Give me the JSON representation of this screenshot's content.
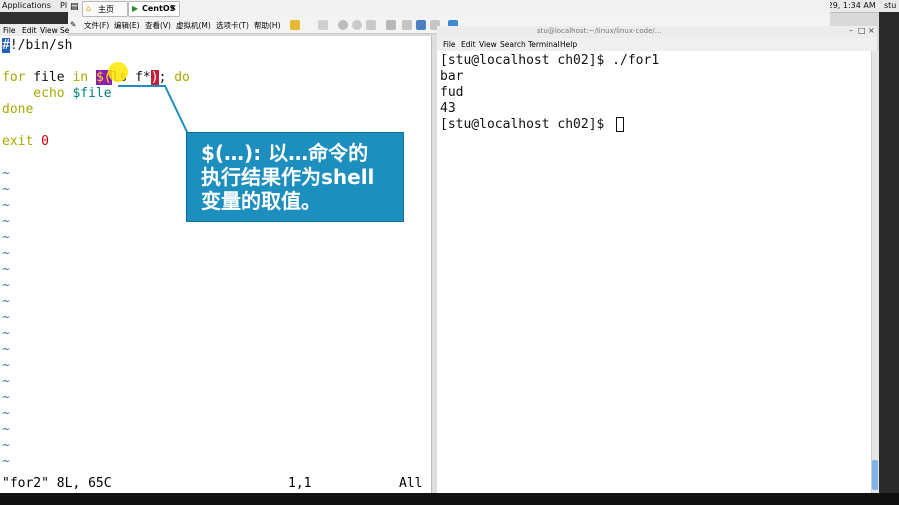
{
  "topbar": {
    "applications": "Applications",
    "places": "Pl",
    "clock": "n 29, 1:34 AM",
    "user": "stu"
  },
  "vm": {
    "tab_home": "主页",
    "tab_centos": "CentOS",
    "menus": [
      "文件(F)",
      "编辑(E)",
      "查看(V)",
      "虚拟机(M)",
      "选项卡(T)",
      "帮助(H)"
    ]
  },
  "vim": {
    "menus": [
      "File",
      "Edit",
      "View",
      "Se"
    ],
    "lines": {
      "shebang_hash": "#",
      "shebang_rest": "!/bin/sh",
      "for_kw": "for",
      "for_var": " file ",
      "in_kw": "in",
      "dollar": "$(",
      "cmd": "ls f*",
      "close": ")",
      "semi": "; ",
      "do_kw": "do",
      "echo_kw": "    echo ",
      "echo_var": "$file",
      "done_kw": "done",
      "exit_kw": "exit ",
      "exit_num": "0"
    },
    "tilde": "~",
    "status_file": "\"for2\" 8L, 65C",
    "status_pos": "1,1",
    "status_all": "All"
  },
  "terminal": {
    "title": "stu@localhost:~/linux/linux-code/...",
    "menus": [
      "File",
      "Edit",
      "View",
      "Search",
      "Terminal",
      "Help"
    ],
    "lines": [
      "[stu@localhost ch02]$ ./for1",
      "bar",
      "fud",
      "43",
      "[stu@localhost ch02]$ "
    ]
  },
  "callout": {
    "line1": "$(…): 以…命令的",
    "line2": "执行结果作为shell",
    "line3": "变量的取值。"
  },
  "colors": {
    "callout_bg": "#1d8fbe",
    "keyword": "#a8a800",
    "variable": "#007f7f",
    "tilde": "#3f7fbf"
  }
}
